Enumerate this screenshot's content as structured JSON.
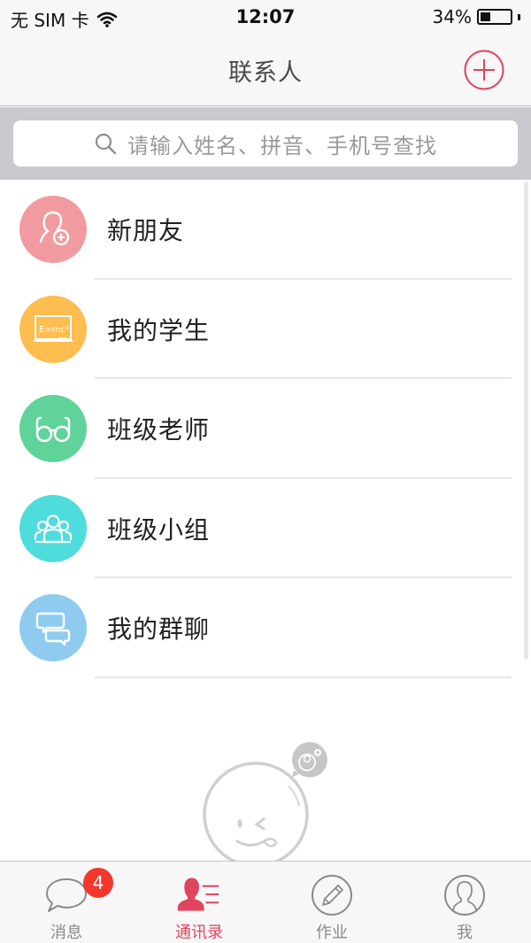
{
  "status_bar": {
    "carrier": "无 SIM 卡",
    "time": "12:07",
    "battery_percent_label": "34%",
    "battery_level": 0.34
  },
  "nav": {
    "title": "联系人",
    "add_icon": "plus-circle-icon"
  },
  "search": {
    "placeholder": "请输入姓名、拼音、手机号查找",
    "icon": "search-icon"
  },
  "contacts_menu": [
    {
      "label": "新朋友",
      "icon": "add-friend-icon",
      "color": "#f19ba0"
    },
    {
      "label": "我的学生",
      "icon": "blackboard-icon",
      "color": "#fdbd4f"
    },
    {
      "label": "班级老师",
      "icon": "glasses-icon",
      "color": "#5fd39a"
    },
    {
      "label": "班级小组",
      "icon": "group-icon",
      "color": "#4fdcdc"
    },
    {
      "label": "我的群聊",
      "icon": "chat-bubbles-icon",
      "color": "#8ecbef"
    }
  ],
  "blackboard_text": "E=mc²",
  "tabs": [
    {
      "label": "消息",
      "icon": "chat-bubble-icon",
      "badge": "4",
      "active": false
    },
    {
      "label": "通讯录",
      "icon": "contacts-icon",
      "active": true
    },
    {
      "label": "作业",
      "icon": "pencil-icon",
      "active": false
    },
    {
      "label": "我",
      "icon": "profile-icon",
      "active": false
    }
  ],
  "colors": {
    "accent": "#e0455e",
    "badge": "#f3372d",
    "tab_inactive": "#8a8a8a"
  }
}
